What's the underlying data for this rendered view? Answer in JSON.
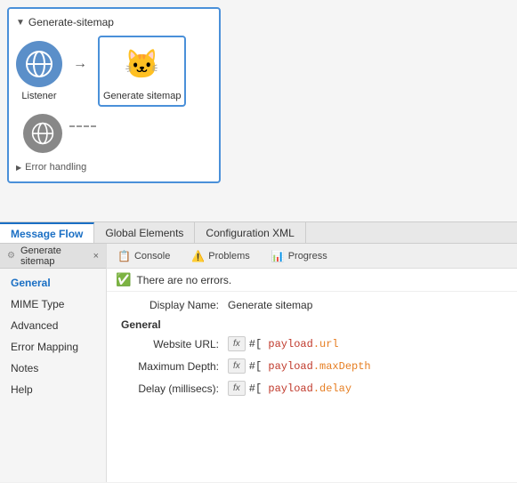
{
  "canvas": {
    "flow_name": "Generate-sitemap",
    "nodes": [
      {
        "id": "listener",
        "label": "Listener",
        "type": "listener"
      },
      {
        "id": "generate-sitemap",
        "label": "Generate sitemap",
        "type": "generate",
        "selected": true
      }
    ],
    "error_handling_label": "Error handling"
  },
  "bottom_tabs": [
    {
      "id": "message-flow",
      "label": "Message Flow",
      "active": true
    },
    {
      "id": "global-elements",
      "label": "Global Elements",
      "active": false
    },
    {
      "id": "configuration-xml",
      "label": "Configuration XML",
      "active": false
    }
  ],
  "panel": {
    "tab_label": "Generate sitemap",
    "close_label": "×",
    "sub_tabs": [
      {
        "id": "console",
        "label": "Console",
        "icon": "📋"
      },
      {
        "id": "problems",
        "label": "Problems",
        "icon": "⚠️"
      },
      {
        "id": "progress",
        "label": "Progress",
        "icon": "📊"
      }
    ],
    "status_message": "There are no errors.",
    "nav_items": [
      {
        "id": "general",
        "label": "General",
        "active": true
      },
      {
        "id": "mime-type",
        "label": "MIME Type",
        "active": false
      },
      {
        "id": "advanced",
        "label": "Advanced",
        "active": false
      },
      {
        "id": "error-mapping",
        "label": "Error Mapping",
        "active": false
      },
      {
        "id": "notes",
        "label": "Notes",
        "active": false
      },
      {
        "id": "help",
        "label": "Help",
        "active": false
      }
    ],
    "form": {
      "display_name_label": "Display Name:",
      "display_name_value": "Generate sitemap",
      "section_label": "General",
      "fields": [
        {
          "label": "Website URL:",
          "expr_prefix": "#[",
          "expr_keyword": "payload",
          "expr_dot": ".",
          "expr_property": "url"
        },
        {
          "label": "Maximum Depth:",
          "expr_prefix": "#[",
          "expr_keyword": "payload",
          "expr_dot": ".",
          "expr_property": "maxDepth"
        },
        {
          "label": "Delay (millisecs):",
          "expr_prefix": "#[",
          "expr_keyword": "payload",
          "expr_dot": ".",
          "expr_property": "delay"
        }
      ]
    }
  }
}
